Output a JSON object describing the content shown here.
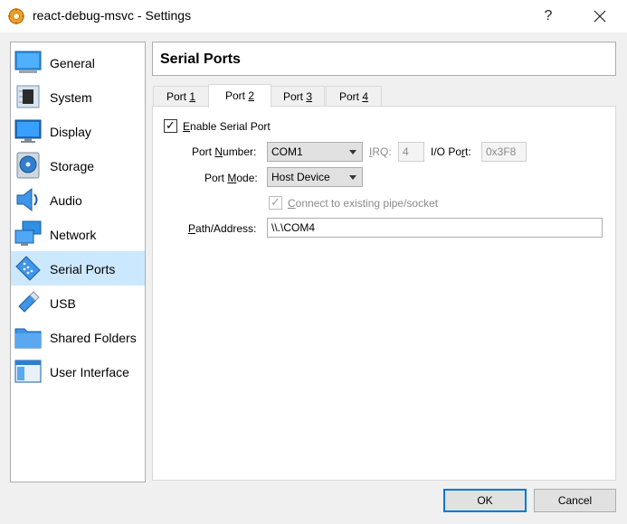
{
  "window": {
    "title": "react-debug-msvc - Settings",
    "help_glyph": "?",
    "close_glyph": "✕"
  },
  "sidebar": {
    "items": [
      {
        "label": "General",
        "icon": "general-icon"
      },
      {
        "label": "System",
        "icon": "system-chip-icon"
      },
      {
        "label": "Display",
        "icon": "display-monitor-icon"
      },
      {
        "label": "Storage",
        "icon": "storage-disk-icon"
      },
      {
        "label": "Audio",
        "icon": "audio-speaker-icon"
      },
      {
        "label": "Network",
        "icon": "network-icon"
      },
      {
        "label": "Serial Ports",
        "icon": "serial-port-icon",
        "selected": true
      },
      {
        "label": "USB",
        "icon": "usb-icon"
      },
      {
        "label": "Shared Folders",
        "icon": "shared-folder-icon"
      },
      {
        "label": "User Interface",
        "icon": "user-interface-icon"
      }
    ]
  },
  "page": {
    "title": "Serial Ports"
  },
  "tabs": [
    {
      "prefix": "Port ",
      "mnemonic": "1"
    },
    {
      "prefix": "Port ",
      "mnemonic": "2",
      "active": true
    },
    {
      "prefix": "Port ",
      "mnemonic": "3"
    },
    {
      "prefix": "Port ",
      "mnemonic": "4"
    }
  ],
  "form": {
    "enable": {
      "mnemonic": "E",
      "rest": "nable Serial Port",
      "checked": true
    },
    "port_number": {
      "pre": "Port ",
      "mnemonic": "N",
      "post": "umber:",
      "value": "COM1"
    },
    "irq": {
      "mnemonic": "I",
      "rest": "RQ:",
      "value": "4"
    },
    "io_port": {
      "pre": "I/O Po",
      "mnemonic": "r",
      "post": "t:",
      "value": "0x3F8"
    },
    "port_mode": {
      "pre": "Port ",
      "mnemonic": "M",
      "post": "ode:",
      "value": "Host Device"
    },
    "connect": {
      "mnemonic": "C",
      "rest": "onnect to existing pipe/socket",
      "checked": true,
      "enabled": false
    },
    "path": {
      "mnemonic": "P",
      "rest": "ath/Address:",
      "value": "\\\\.\\COM4"
    }
  },
  "buttons": {
    "ok": "OK",
    "cancel": "Cancel"
  },
  "colors": {
    "accent": "#0078d7",
    "selection": "#cce8ff"
  }
}
